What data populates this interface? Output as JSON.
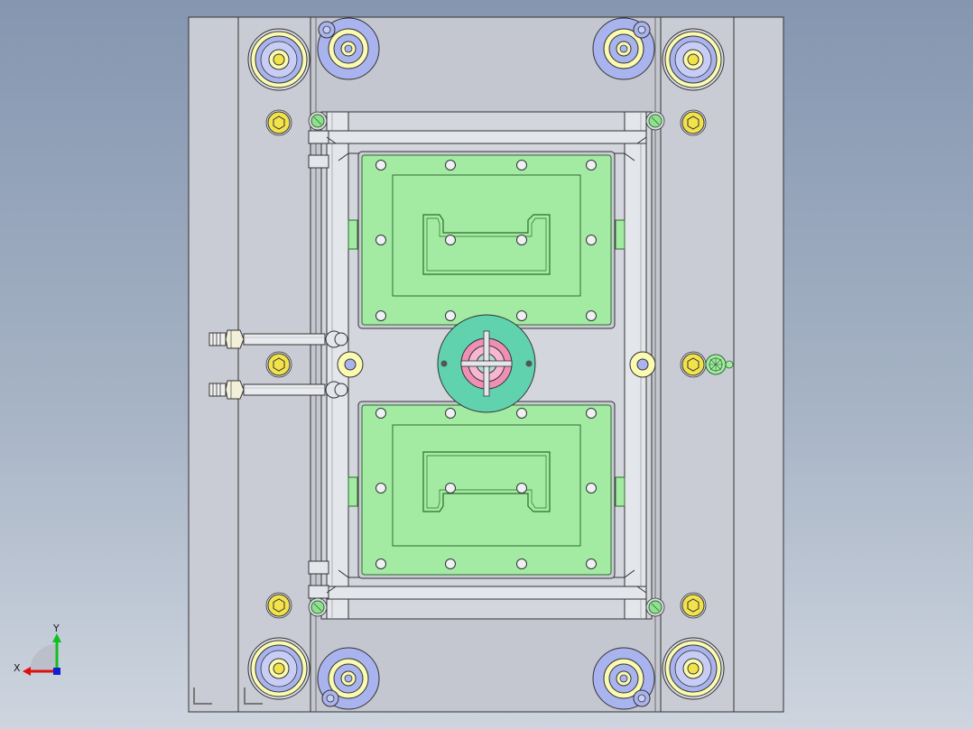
{
  "viewport": {
    "background_top": "#8596b0",
    "background_bottom": "#ced5df"
  },
  "triad": {
    "x_label": "X",
    "y_label": "Y",
    "x_color": "#e01010",
    "y_color": "#10c020",
    "z_color": "#1020d0"
  },
  "colors": {
    "plate": "#c9ccd4",
    "plate_dark": "#b9bcc5",
    "cavity": "#a3eba3",
    "cavity_edge": "#2f6b2f",
    "bushing_blue": "#a9b4ee",
    "bushing_yellow": "#fafab0",
    "bolt_yellow": "#f2e24b",
    "sprue_teal": "#60d2ae",
    "sprue_pink": "#ef8fb4"
  },
  "icons": {
    "guide_pillar": "guide-pillar-icon",
    "bolt": "hex-bolt-icon",
    "water_fitting": "water-fitting-icon",
    "sprue": "sprue-bushing-icon"
  }
}
